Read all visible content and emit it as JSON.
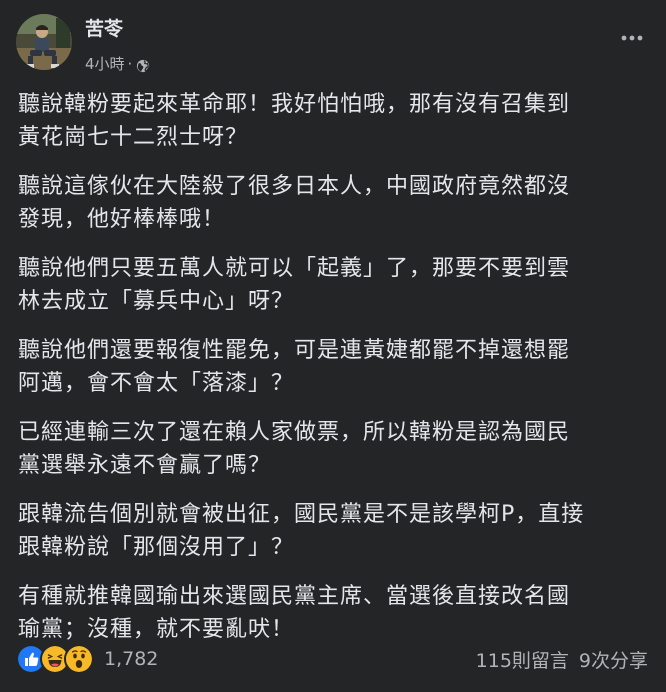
{
  "post": {
    "author": "苦苓",
    "time": "4小時",
    "separator": "·",
    "paragraphs": [
      "聽說韓粉要起來革命耶！我好怕怕哦，那有沒有召集到\n黃花崗七十二烈士呀？",
      "聽說這傢伙在大陸殺了很多日本人，中國政府竟然都沒\n發現，他好棒棒哦！",
      "聽說他們只要五萬人就可以「起義」了，那要不要到雲\n林去成立「募兵中心」呀？",
      "聽說他們還要報復性罷免，可是連黃婕都罷不掉還想罷\n阿邁，會不會太「落漆」？",
      "已經連輸三次了還在賴人家做票，所以韓粉是認為國民\n黨選舉永遠不會贏了嗎？",
      "跟韓流告個別就會被出征，國民黨是不是該學柯P，直接\n跟韓粉說「那個沒用了」？",
      "有種就推韓國瑜出來選國民黨主席、當選後直接改名國\n瑜黨；沒種，就不要亂吠！"
    ],
    "reaction_icons": [
      "like-icon",
      "haha-icon",
      "wow-icon"
    ],
    "reaction_count": "1,782",
    "comments": "115則留言",
    "shares": "9次分享"
  },
  "colors": {
    "background": "#242526",
    "text": "#e4e6eb",
    "secondary_text": "#b0b3b8",
    "like_blue": "#2078f4",
    "reaction_yellow": "#f7b928"
  }
}
